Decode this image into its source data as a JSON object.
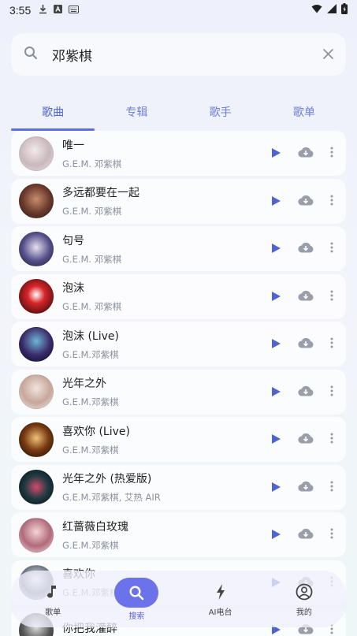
{
  "status_bar": {
    "time": "3:55"
  },
  "search": {
    "query": "邓紫棋"
  },
  "tabs": [
    {
      "label": "歌曲",
      "active": true
    },
    {
      "label": "专辑",
      "active": false
    },
    {
      "label": "歌手",
      "active": false
    },
    {
      "label": "歌单",
      "active": false
    }
  ],
  "songs": [
    {
      "title": "唯一",
      "artist": "G.E.M. 邓紫棋"
    },
    {
      "title": "多远都要在一起",
      "artist": "G.E.M. 邓紫棋"
    },
    {
      "title": "句号",
      "artist": "G.E.M. 邓紫棋"
    },
    {
      "title": "泡沫",
      "artist": "G.E.M. 邓紫棋"
    },
    {
      "title": "泡沫 (Live)",
      "artist": "G.E.M.邓紫棋"
    },
    {
      "title": "光年之外",
      "artist": "G.E.M.邓紫棋"
    },
    {
      "title": "喜欢你 (Live)",
      "artist": "G.E.M.邓紫棋"
    },
    {
      "title": "光年之外 (热爱版)",
      "artist": "G.E.M.邓紫棋, 艾热 AIR"
    },
    {
      "title": "红蔷薇白玫瑰",
      "artist": "G.E.M.邓紫棋"
    },
    {
      "title": "喜欢你",
      "artist": "G.E.M.邓紫棋"
    },
    {
      "title": "你把我灌醉",
      "artist": ""
    }
  ],
  "nav": [
    {
      "label": "歌单",
      "icon": "music-note-icon",
      "active": false
    },
    {
      "label": "搜索",
      "icon": "search-icon",
      "active": true
    },
    {
      "label": "AI电台",
      "icon": "bolt-icon",
      "active": false
    },
    {
      "label": "我的",
      "icon": "user-circle-icon",
      "active": false
    }
  ],
  "colors": {
    "accent": "#5b6fe0",
    "play": "#4f63d2",
    "download": "#9a9ea8"
  }
}
